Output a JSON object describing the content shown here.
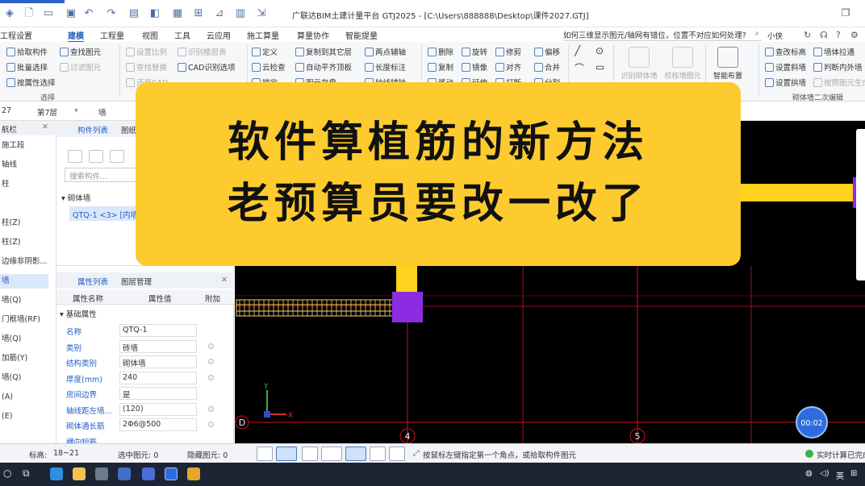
{
  "window": {
    "title": "广联达BIM土建计量平台 GTJ2025 - [C:\\Users\\888888\\Desktop\\课件2027.GTJ]",
    "top_tab_color": "#2c63c7"
  },
  "menu": {
    "items": [
      "工程设置",
      "建模",
      "工程量",
      "视图",
      "工具",
      "云应用",
      "施工算量",
      "算量协作",
      "智能提量"
    ],
    "active_index": 1,
    "help_query": "如何三维显示图元/轴网有错位，位置不对应如何处理?",
    "user": "小侠"
  },
  "ribbon": {
    "select_group": {
      "items": [
        "拾取构件",
        "批量选择",
        "按属性选择"
      ],
      "label": "选择"
    },
    "find_group": {
      "items": [
        "查找图元",
        "过滤图元"
      ]
    },
    "cad_group": {
      "items": [
        "设置比例",
        "识别楼层表",
        "查找替换",
        "CAD识别选项",
        "还原CAD"
      ]
    },
    "general_group": {
      "items": [
        "定义",
        "云检查",
        "锁定",
        "复制到其它层",
        "自动平齐顶板",
        "图元存盘",
        "两点辅轴",
        "长度标注",
        "轴线辅轴"
      ]
    },
    "modify_group": {
      "items": [
        "删除",
        "旋转",
        "修剪",
        "偏移",
        "复制",
        "镜像",
        "对齐",
        "合并",
        "移动",
        "延伸",
        "打断",
        "分割"
      ]
    },
    "recognize_group": {
      "items": [
        "识别砌体墙",
        "校核墙图元"
      ]
    },
    "smart_layout": "智能布置",
    "masonry_group": {
      "items": [
        "查改标高",
        "墙体拉通",
        "设置斜墙",
        "判断内外墙",
        "设置拱墙",
        "按照图元生成"
      ],
      "label": "砌体墙二次编辑"
    }
  },
  "floorbar": {
    "floor_left": "27",
    "floor": "第7层",
    "component_type": "墙"
  },
  "nav": {
    "header": "航栏",
    "items": [
      "施工段",
      "轴线",
      "柱",
      "",
      "柱(Z)",
      "柱(Z)",
      "边缘非阴影...",
      "墙",
      "墙(Q)",
      "门框墙(RF)",
      "墙(Q)",
      "加筋(Y)",
      "墙(Q)",
      "(A)",
      "(E)"
    ],
    "active_index": 7
  },
  "component_panel": {
    "tabs": [
      "构件列表",
      "图纸"
    ],
    "search_placeholder": "搜索构件...",
    "tree_root": "砌体墙",
    "selected_item": "QTQ-1 <3> [内墙]"
  },
  "properties_panel": {
    "tabs": [
      "属性列表",
      "图层管理"
    ],
    "columns": [
      "属性名称",
      "属性值",
      "附加"
    ],
    "group": "基础属性",
    "rows": [
      {
        "name": "名称",
        "value": "QTQ-1",
        "boxed": true,
        "check": false
      },
      {
        "name": "类别",
        "value": "砖墙",
        "boxed": true,
        "check": true
      },
      {
        "name": "结构类别",
        "value": "砌体墙",
        "boxed": true,
        "check": true
      },
      {
        "name": "厚度(mm)",
        "value": "240",
        "boxed": true,
        "check": true
      },
      {
        "name": "房间边界",
        "value": "是",
        "boxed": true,
        "check": false
      },
      {
        "name": "轴线距左墙...",
        "value": "(120)",
        "boxed": true,
        "check": true
      },
      {
        "name": "砌体通长筋",
        "value": "2Φ6@500",
        "boxed": true,
        "check": true
      },
      {
        "name": "横向短筋",
        "value": "",
        "boxed": false,
        "check": false
      }
    ]
  },
  "canvas": {
    "axis_labels": [
      "D",
      "4",
      "5"
    ],
    "axis_x": "X",
    "axis_y": "Y",
    "timer": "00:02",
    "colors": {
      "background": "#000000",
      "grid": "#d01020",
      "wall": "#ffd21e",
      "column": "#8b2be2",
      "rebar": "#f6d36a"
    }
  },
  "banner": {
    "line1": "软件算植筋的新方法",
    "line2": "老预算员要改一改了",
    "color": "#fecb2f"
  },
  "statusbar": {
    "floor_height_label": "标高:",
    "floor_height": "18~21",
    "selected": "选中图元: 0",
    "hidden": "隐藏图元: 0",
    "hint": "按鼠标左键指定第一个角点，或拾取构件图元",
    "realtime": "实时计算已完成"
  },
  "taskbar": {
    "ime": "英"
  }
}
